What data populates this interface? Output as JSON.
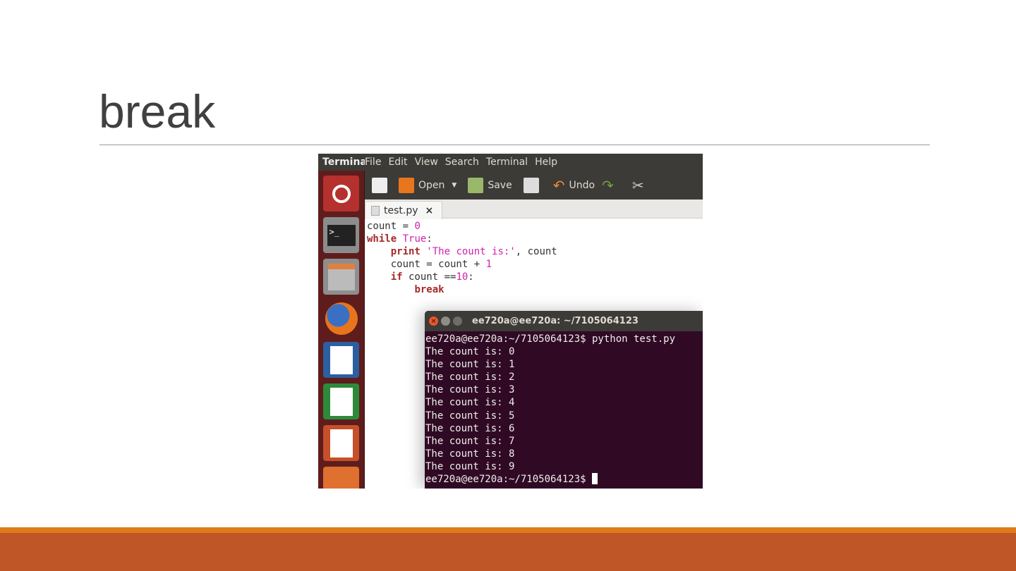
{
  "slide": {
    "title": "break"
  },
  "menubar": {
    "app": "Terminal",
    "items": [
      "File",
      "Edit",
      "View",
      "Search",
      "Terminal",
      "Help"
    ]
  },
  "toolbar": {
    "open": "Open",
    "save": "Save",
    "undo": "Undo"
  },
  "editor": {
    "tab": "test.py",
    "tab_close": "×",
    "lines": [
      "count = ",
      "0",
      "while",
      " True",
      ":",
      "print",
      " 'The count is:'",
      ", count",
      "count = count + ",
      "1",
      "if",
      " count ==",
      "10",
      ":",
      "break"
    ]
  },
  "terminal": {
    "title": "ee720a@ee720a: ~/7105064123",
    "command": "ee720a@ee720a:~/7105064123$ python test.py",
    "output": [
      "The count is: 0",
      "The count is: 1",
      "The count is: 2",
      "The count is: 3",
      "The count is: 4",
      "The count is: 5",
      "The count is: 6",
      "The count is: 7",
      "The count is: 8",
      "The count is: 9"
    ],
    "prompt": "ee720a@ee720a:~/7105064123$ "
  },
  "colors": {
    "accent": "#bf5628",
    "accent_light": "#e07b1a",
    "terminal_bg": "#300a24"
  }
}
